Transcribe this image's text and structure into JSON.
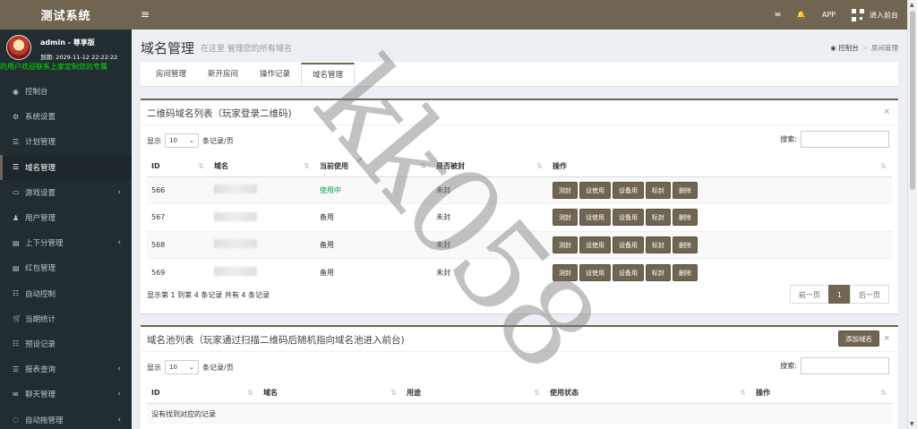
{
  "app": {
    "logo_text": "测试系统"
  },
  "user": {
    "name": "admin - 尊享版",
    "expire": "到期: 2029-11-12 22:22:22",
    "marquee": "的用户欢迎联系上家定制您的专属"
  },
  "sidebar": {
    "items": [
      {
        "label": "控制台",
        "icon": "dashboard-icon",
        "glyph": "◉",
        "chevron": ""
      },
      {
        "label": "系统设置",
        "icon": "cogs-icon",
        "glyph": "⚙",
        "chevron": ""
      },
      {
        "label": "计划管理",
        "icon": "list-icon",
        "glyph": "☰",
        "chevron": ""
      },
      {
        "label": "域名管理",
        "icon": "list-icon",
        "glyph": "☰",
        "chevron": "",
        "active": true
      },
      {
        "label": "游戏设置",
        "icon": "gamepad-icon",
        "glyph": "▭",
        "chevron": "‹"
      },
      {
        "label": "用户管理",
        "icon": "users-icon",
        "glyph": "♟",
        "chevron": ""
      },
      {
        "label": "上下分管理",
        "icon": "database-icon",
        "glyph": "▤",
        "chevron": "‹"
      },
      {
        "label": "红包管理",
        "icon": "database-icon",
        "glyph": "▤",
        "chevron": ""
      },
      {
        "label": "自动控制",
        "icon": "list-alt-icon",
        "glyph": "☷",
        "chevron": ""
      },
      {
        "label": "当期统计",
        "icon": "cart-icon",
        "glyph": "🛒",
        "chevron": ""
      },
      {
        "label": "预设记录",
        "icon": "list-alt-icon",
        "glyph": "☷",
        "chevron": ""
      },
      {
        "label": "报表查询",
        "icon": "list-icon",
        "glyph": "☰",
        "chevron": "‹"
      },
      {
        "label": "聊天管理",
        "icon": "chat-icon",
        "glyph": "✉",
        "chevron": "‹"
      },
      {
        "label": "自动拖管理",
        "icon": "comment-icon",
        "glyph": "◌",
        "chevron": "‹"
      }
    ]
  },
  "topbar": {
    "menu_toggle": "≡",
    "mail_glyph": "✉",
    "bell_glyph": "🔔",
    "app_label": "APP",
    "enter_label": "进入前台"
  },
  "page": {
    "title": "域名管理",
    "subtitle": "在这里 管理您的所有域名",
    "breadcrumb_home": "控制台",
    "breadcrumb_current": "房间管理"
  },
  "tabs": [
    "房间管理",
    "新开房间",
    "操作记录",
    "域名管理"
  ],
  "table1": {
    "title": "二维码域名列表（玩家登录二维码)",
    "show_label": "显示",
    "per_page": "10",
    "per_page_suffix": "条记录/页",
    "search_label": "搜索:",
    "columns": [
      "ID",
      "域名",
      "当前使用",
      "是否被封",
      "操作"
    ],
    "rows": [
      {
        "id": "566",
        "usage": "使用中",
        "banned": "未封"
      },
      {
        "id": "567",
        "usage": "备用",
        "banned": "未封"
      },
      {
        "id": "568",
        "usage": "备用",
        "banned": "未封"
      },
      {
        "id": "569",
        "usage": "备用",
        "banned": "未封"
      }
    ],
    "actions": [
      "测封",
      "设使用",
      "设备用",
      "标封",
      "删除"
    ],
    "info": "显示第 1 到第 4 条记录 共有 4 条记录",
    "pager": {
      "prev": "前一页",
      "current": "1",
      "next": "后一页"
    }
  },
  "table2": {
    "title": "域名池列表（玩家通过扫描二维码后随机指向域名池进入前台)",
    "add_button": "添加域名",
    "show_label": "显示",
    "per_page": "10",
    "per_page_suffix": "条记录/页",
    "search_label": "搜索:",
    "columns": [
      "ID",
      "域名",
      "用途",
      "使用状态",
      "操作"
    ],
    "empty": "没有找到对应的记录"
  },
  "close_glyph": "×",
  "watermark": "kk058",
  "colors": {
    "accent": "#6f6550",
    "sidebar_bg": "#222d32",
    "green": "#00a65a"
  }
}
